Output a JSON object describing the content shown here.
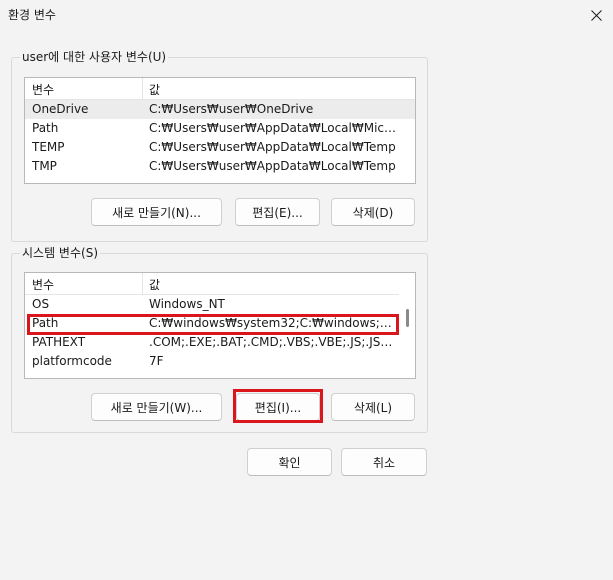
{
  "window": {
    "title": "환경 변수"
  },
  "user_vars": {
    "label": "user에 대한 사용자 변수(U)",
    "header": {
      "name": "변수",
      "value": "값"
    },
    "rows": [
      {
        "name": "OneDrive",
        "value": "C:₩Users₩user₩OneDrive"
      },
      {
        "name": "Path",
        "value": "C:₩Users₩user₩AppData₩Local₩Microsoft..."
      },
      {
        "name": "TEMP",
        "value": "C:₩Users₩user₩AppData₩Local₩Temp"
      },
      {
        "name": "TMP",
        "value": "C:₩Users₩user₩AppData₩Local₩Temp"
      }
    ],
    "buttons": {
      "new": "새로 만들기(N)...",
      "edit": "편집(E)...",
      "delete": "삭제(D)"
    }
  },
  "system_vars": {
    "label": "시스템 변수(S)",
    "header": {
      "name": "변수",
      "value": "값"
    },
    "rows": [
      {
        "name": "OS",
        "value": "Windows_NT"
      },
      {
        "name": "Path",
        "value": "C:₩windows₩system32;C:₩windows;C:₩wi..."
      },
      {
        "name": "PATHEXT",
        "value": ".COM;.EXE;.BAT;.CMD;.VBS;.VBE;.JS;.JSE;.W..."
      },
      {
        "name": "platformcode",
        "value": "7F"
      }
    ],
    "buttons": {
      "new": "새로 만들기(W)...",
      "edit": "편집(I)...",
      "delete": "삭제(L)"
    }
  },
  "footer": {
    "ok": "확인",
    "cancel": "취소"
  },
  "colors": {
    "highlight": "#d9161b",
    "selected_row": "#ececec"
  },
  "icons": {
    "close": "close-icon"
  }
}
